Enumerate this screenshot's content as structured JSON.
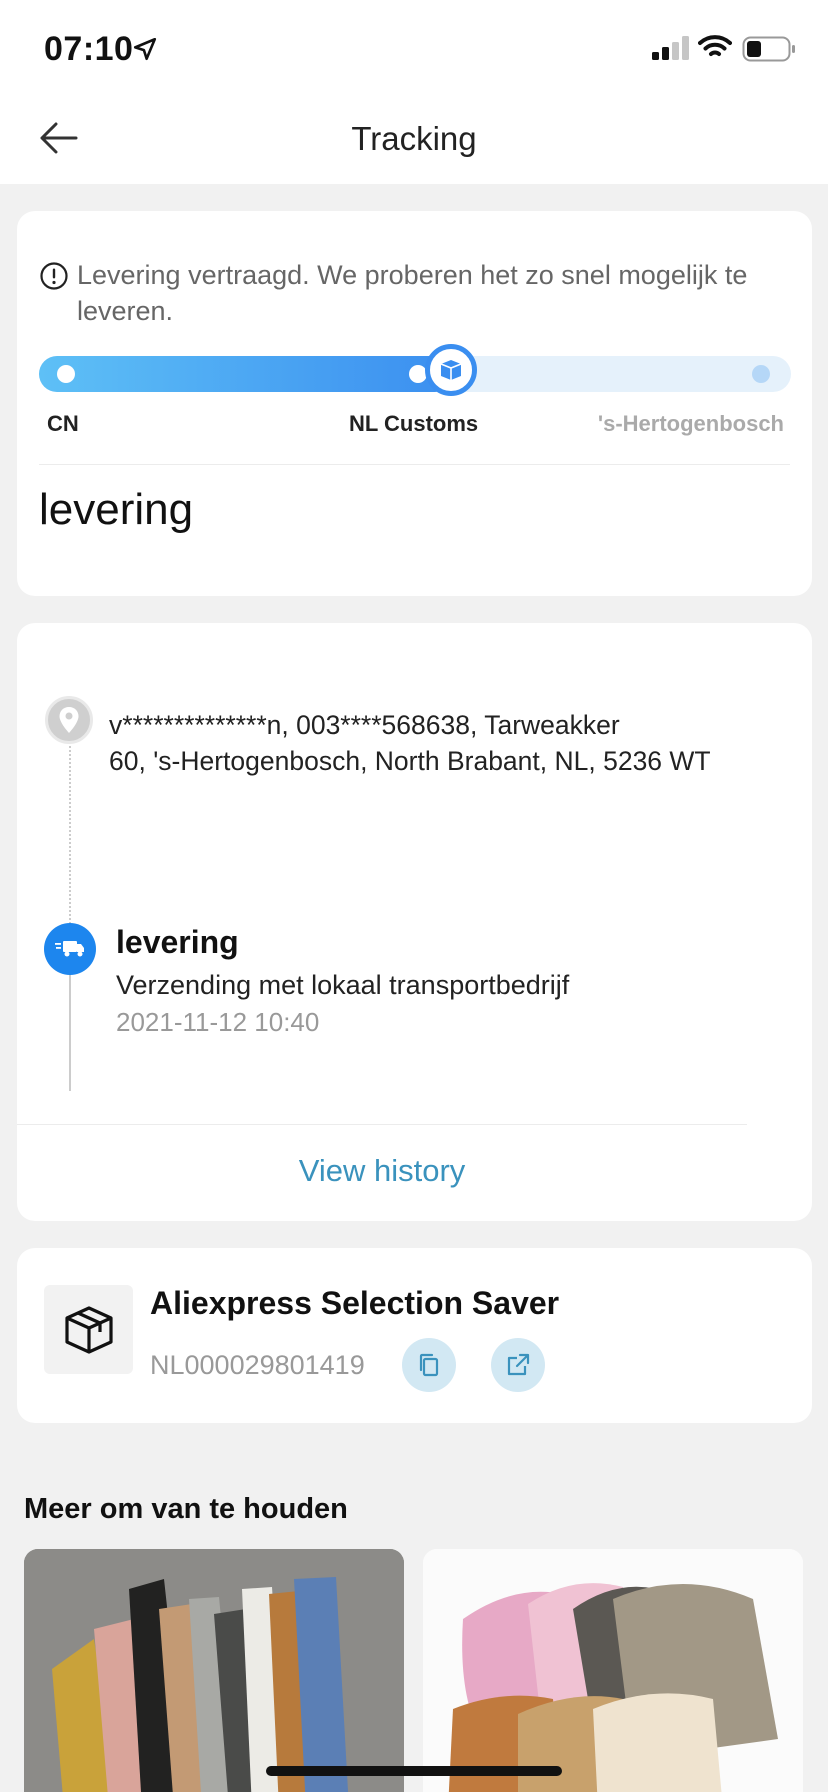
{
  "status_bar": {
    "time": "07:10"
  },
  "header": {
    "title": "Tracking"
  },
  "progress_card": {
    "notice": "Levering vertraagd. We proberen het zo snel mogelijk te leveren.",
    "progress_fraction": 0.55,
    "stops": [
      "CN",
      "NL Customs",
      "'s-Hertogenbosch"
    ],
    "status": "levering"
  },
  "timeline_card": {
    "address": "v**************n,  003****568638,  Tarweakker\n60,  's-Hertogenbosch,  North Brabant,  NL,  5236 WT",
    "event": {
      "title": "levering",
      "description": "Verzending met lokaal transportbedrijf",
      "time": "2021-11-12 10:40"
    },
    "view_history_label": "View history"
  },
  "carrier_card": {
    "name": "Aliexpress Selection Saver",
    "tracking_number": "NL000029801419"
  },
  "recommendations": {
    "heading": "Meer om van te houden"
  },
  "colors": {
    "accent_blue": "#3a8ef0",
    "link_blue": "#3a92bd"
  }
}
